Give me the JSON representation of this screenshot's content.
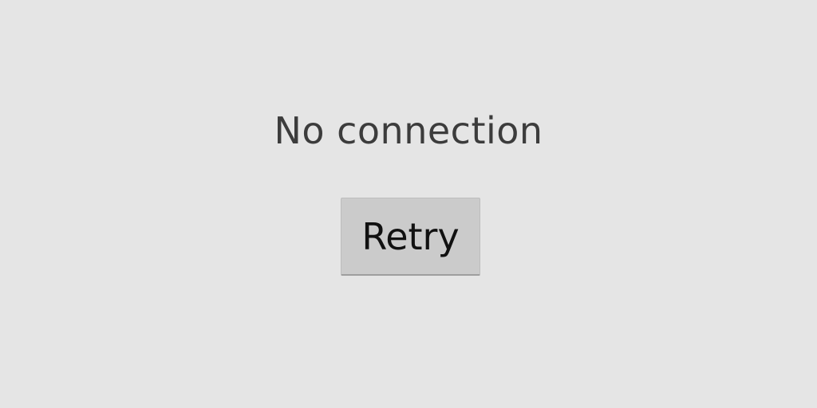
{
  "error_state": {
    "message": "No connection",
    "retry_label": "Retry"
  },
  "colors": {
    "background": "#e5e5e5",
    "message_text": "#3c3c3c",
    "button_background": "#cbcbcb",
    "button_text": "#111111"
  }
}
